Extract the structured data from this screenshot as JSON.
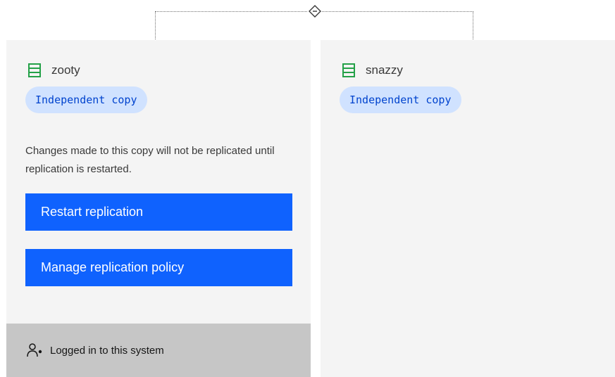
{
  "colors": {
    "accent": "#0f62fe",
    "tag_bg": "#d0e2ff",
    "tag_text": "#0043ce",
    "db_icon": "#24a148",
    "card_bg": "#f4f4f4",
    "footer_bg": "#c6c6c6"
  },
  "connector": {
    "icon": "diamond-link-icon"
  },
  "left_system": {
    "icon": "database-icon",
    "name": "zooty",
    "tag": "Independent copy",
    "description": "Changes made to this copy will not be replicated until replication is restarted.",
    "restart_button": "Restart replication",
    "manage_button": "Manage replication policy",
    "footer": {
      "icon": "user-logged-in-icon",
      "text": "Logged in to this system"
    }
  },
  "right_system": {
    "icon": "database-icon",
    "name": "snazzy",
    "tag": "Independent copy"
  }
}
